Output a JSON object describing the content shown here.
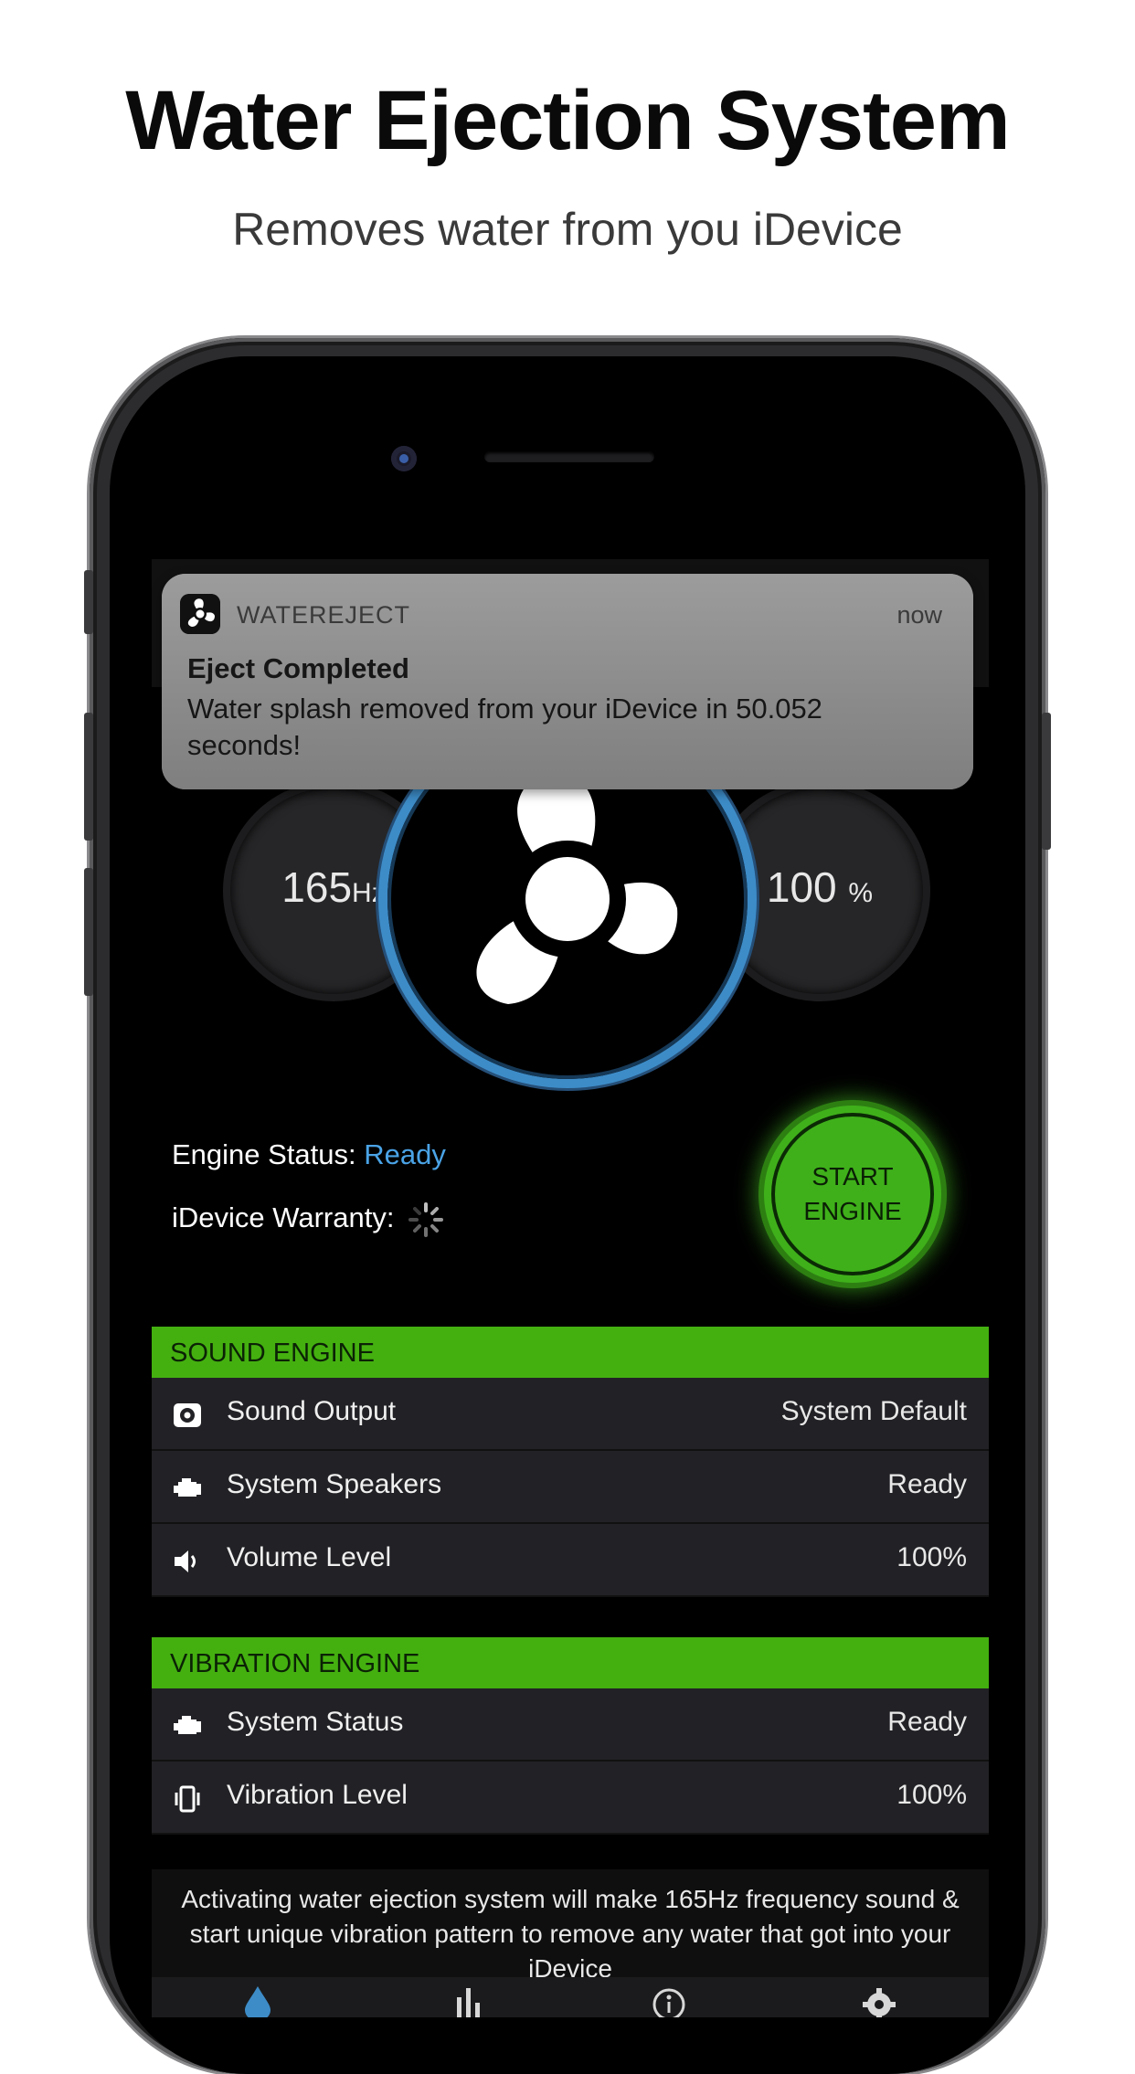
{
  "promo": {
    "headline": "Water Ejection System",
    "subheadline": "Removes water from you iDevice"
  },
  "notification": {
    "app_name": "WATEREJECT",
    "time": "now",
    "title": "Eject Completed",
    "body": "Water splash removed from your iDevice in 50.052 seconds!"
  },
  "gauges": {
    "frequency_value": "165",
    "frequency_unit": "Hz",
    "level_value": "100",
    "level_unit": "%"
  },
  "status": {
    "engine_label": "Engine Status:",
    "engine_value": "Ready",
    "warranty_label": "iDevice Warranty:"
  },
  "start_button": {
    "line1": "START",
    "line2": "ENGINE"
  },
  "sound_engine": {
    "header": "SOUND ENGINE",
    "rows": [
      {
        "icon": "speaker-output-icon",
        "label": "Sound Output",
        "value": "System Default"
      },
      {
        "icon": "engine-icon",
        "label": "System Speakers",
        "value": "Ready"
      },
      {
        "icon": "volume-icon",
        "label": "Volume Level",
        "value": "100%"
      }
    ]
  },
  "vibration_engine": {
    "header": "VIBRATION ENGINE",
    "rows": [
      {
        "icon": "engine-icon",
        "label": "System Status",
        "value": "Ready"
      },
      {
        "icon": "vibration-icon",
        "label": "Vibration Level",
        "value": "100%"
      }
    ]
  },
  "footer": {
    "text": "Activating water ejection system will make 165Hz frequency sound & start unique vibration pattern to remove any water that got into your iDevice"
  },
  "tabs": [
    "water-drop-icon",
    "equalizer-icon",
    "info-icon",
    "gear-icon"
  ],
  "colors": {
    "accent_green": "#44b010",
    "accent_blue": "#4aa3e6",
    "background": "#000000"
  }
}
